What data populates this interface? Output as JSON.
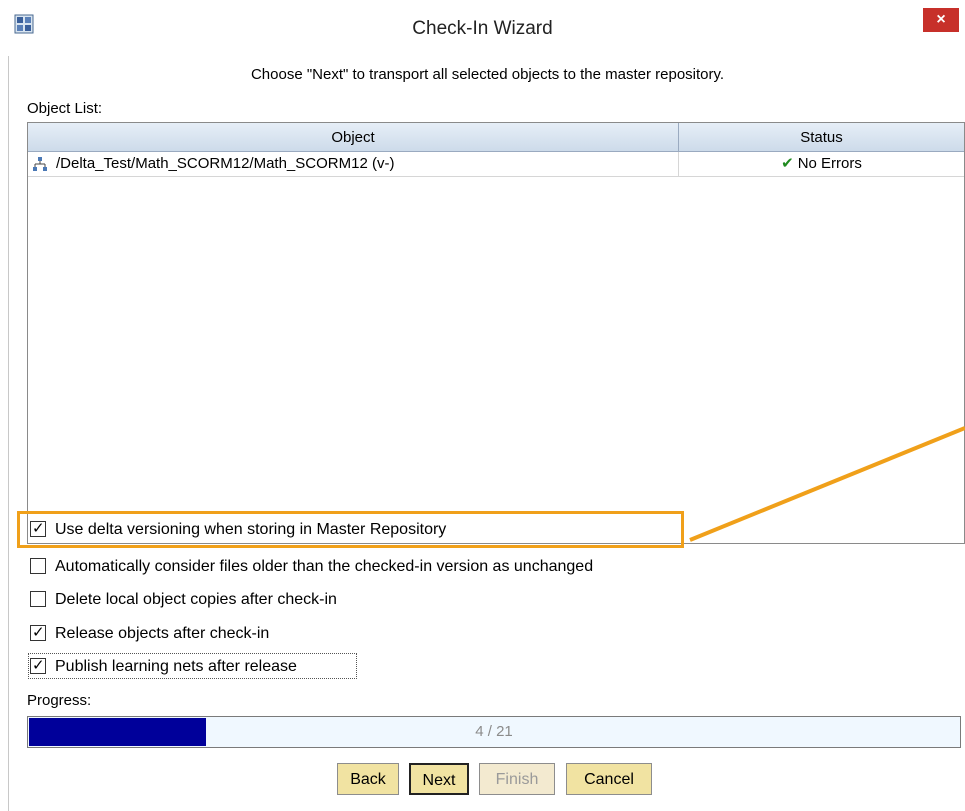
{
  "window": {
    "title": "Check-In Wizard",
    "close_glyph": "×"
  },
  "instruction": "Choose \"Next\" to transport all selected objects to the master repository.",
  "object_list": {
    "label": "Object List:",
    "columns": [
      "Object",
      "Status"
    ],
    "rows": [
      {
        "object": "/Delta_Test/Math_SCORM12/Math_SCORM12 (v-)",
        "status": "No Errors",
        "icon": "learning-net-icon",
        "status_icon": "check-icon"
      }
    ]
  },
  "options": [
    {
      "label": "Use delta versioning when storing in Master Repository",
      "checked": true
    },
    {
      "label": "Automatically consider files older than the checked-in version as unchanged",
      "checked": false
    },
    {
      "label": "Delete local object copies after check-in",
      "checked": false
    },
    {
      "label": "Release objects after check-in",
      "checked": true
    },
    {
      "label": "Publish learning nets after release",
      "checked": true
    }
  ],
  "progress": {
    "label": "Progress:",
    "text": "4 / 21",
    "current": 4,
    "total": 21
  },
  "buttons": {
    "back": "Back",
    "next": "Next",
    "finish": "Finish",
    "cancel": "Cancel"
  },
  "colors": {
    "highlight": "#f0a01a",
    "progress_fill": "#00009a",
    "button_bg": "#f1e3a2",
    "close_bg": "#c7302a"
  }
}
